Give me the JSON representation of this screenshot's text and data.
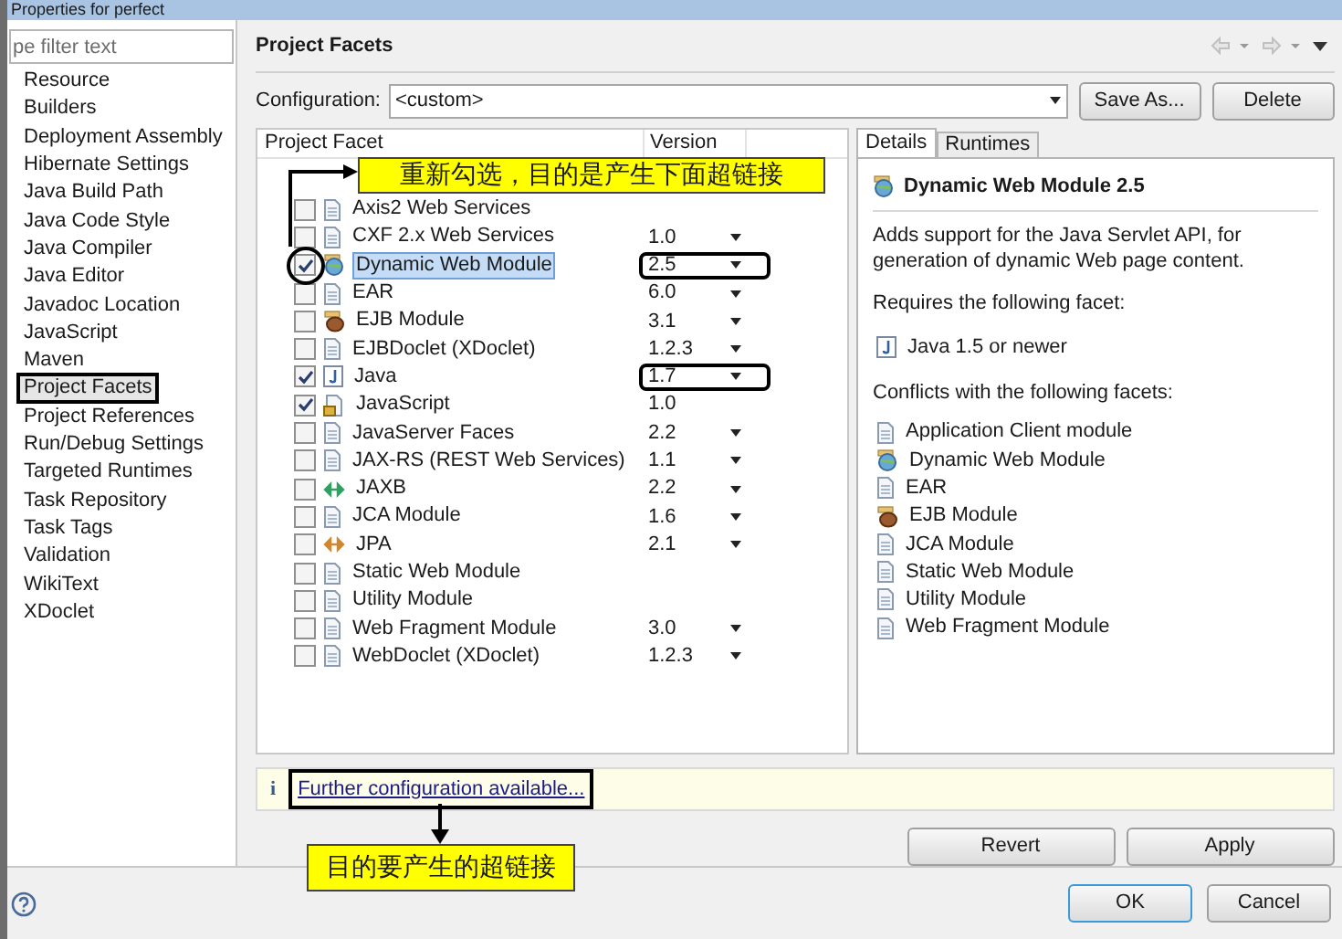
{
  "window": {
    "title": "Properties for perfect"
  },
  "sidebar": {
    "filter_placeholder": "pe filter text",
    "items": [
      {
        "label": "Resource",
        "selected": false
      },
      {
        "label": "Builders",
        "selected": false
      },
      {
        "label": "Deployment Assembly",
        "selected": false
      },
      {
        "label": "Hibernate Settings",
        "selected": false
      },
      {
        "label": "Java Build Path",
        "selected": false
      },
      {
        "label": "Java Code Style",
        "selected": false
      },
      {
        "label": "Java Compiler",
        "selected": false
      },
      {
        "label": "Java Editor",
        "selected": false
      },
      {
        "label": "Javadoc Location",
        "selected": false
      },
      {
        "label": "JavaScript",
        "selected": false
      },
      {
        "label": "Maven",
        "selected": false
      },
      {
        "label": "Project Facets",
        "selected": true
      },
      {
        "label": "Project References",
        "selected": false
      },
      {
        "label": "Run/Debug Settings",
        "selected": false
      },
      {
        "label": "Targeted Runtimes",
        "selected": false
      },
      {
        "label": "Task Repository",
        "selected": false
      },
      {
        "label": "Task Tags",
        "selected": false
      },
      {
        "label": "Validation",
        "selected": false
      },
      {
        "label": "WikiText",
        "selected": false
      },
      {
        "label": "XDoclet",
        "selected": false
      }
    ]
  },
  "page_title": "Project Facets",
  "configuration": {
    "label": "Configuration:",
    "value": "<custom>",
    "buttons": [
      "Save As...",
      "Delete"
    ]
  },
  "facets": {
    "columns": [
      "Project Facet",
      "Version"
    ],
    "rows": [
      {
        "name": "Axis2 Web Services",
        "kind": "file",
        "checked": false,
        "selected": false,
        "version": ""
      },
      {
        "name": "CXF 2.x Web Services",
        "kind": "file",
        "checked": false,
        "selected": false,
        "version": "1.0"
      },
      {
        "name": "Dynamic Web Module",
        "kind": "web",
        "checked": true,
        "selected": true,
        "version": "2.5"
      },
      {
        "name": "EAR",
        "kind": "file",
        "checked": false,
        "selected": false,
        "version": "6.0"
      },
      {
        "name": "EJB Module",
        "kind": "ejb",
        "checked": false,
        "selected": false,
        "version": "3.1"
      },
      {
        "name": "EJBDoclet (XDoclet)",
        "kind": "file",
        "checked": false,
        "selected": false,
        "version": "1.2.3"
      },
      {
        "name": "Java",
        "kind": "java",
        "checked": true,
        "selected": false,
        "version": "1.7"
      },
      {
        "name": "JavaScript",
        "kind": "script",
        "checked": true,
        "selected": false,
        "version": "1.0"
      },
      {
        "name": "JavaServer Faces",
        "kind": "file",
        "checked": false,
        "selected": false,
        "version": "2.2"
      },
      {
        "name": "JAX-RS (REST Web Services)",
        "kind": "file",
        "checked": false,
        "selected": false,
        "version": "1.1"
      },
      {
        "name": "JAXB",
        "kind": "binding",
        "checked": false,
        "selected": false,
        "version": "2.2"
      },
      {
        "name": "JCA Module",
        "kind": "file",
        "checked": false,
        "selected": false,
        "version": "1.6"
      },
      {
        "name": "JPA",
        "kind": "persistence",
        "checked": false,
        "selected": false,
        "version": "2.1"
      },
      {
        "name": "Static Web Module",
        "kind": "file",
        "checked": false,
        "selected": false,
        "version": ""
      },
      {
        "name": "Utility Module",
        "kind": "file",
        "checked": false,
        "selected": false,
        "version": ""
      },
      {
        "name": "Web Fragment Module",
        "kind": "file",
        "checked": false,
        "selected": false,
        "version": "3.0"
      },
      {
        "name": "WebDoclet (XDoclet)",
        "kind": "file",
        "checked": false,
        "selected": false,
        "version": "1.2.3"
      }
    ]
  },
  "details": {
    "tabs": [
      {
        "label": "Details",
        "selected": true
      },
      {
        "label": "Runtimes",
        "selected": false
      }
    ],
    "title": "Dynamic Web Module 2.5",
    "description": "Adds support for the Java Servlet API, for generation of dynamic Web page content.",
    "requires_label": "Requires the following facet:",
    "requires": [
      {
        "name": "Java 1.5 or newer",
        "kind": "java"
      }
    ],
    "conflicts_label": "Conflicts with the following facets:",
    "conflicts": [
      {
        "name": "Application Client module",
        "kind": "file"
      },
      {
        "name": "Dynamic Web Module",
        "kind": "web"
      },
      {
        "name": "EAR",
        "kind": "file"
      },
      {
        "name": "EJB Module",
        "kind": "ejb"
      },
      {
        "name": "JCA Module",
        "kind": "file"
      },
      {
        "name": "Static Web Module",
        "kind": "file"
      },
      {
        "name": "Utility Module",
        "kind": "file"
      },
      {
        "name": "Web Fragment Module",
        "kind": "file"
      }
    ]
  },
  "info_bar": {
    "icon": "i",
    "link": "Further configuration available..."
  },
  "page_buttons": [
    "Revert",
    "Apply"
  ],
  "dialog_buttons": [
    "OK",
    "Cancel"
  ],
  "annotations": [
    {
      "text": "重新勾选，目的是产生下面超链接"
    },
    {
      "text": "目的要产生的超链接"
    }
  ]
}
